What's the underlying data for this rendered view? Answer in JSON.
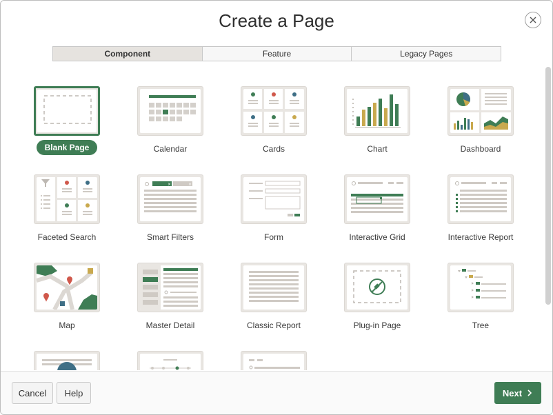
{
  "dialog": {
    "title": "Create a Page"
  },
  "tabs": [
    {
      "label": "Component"
    },
    {
      "label": "Feature"
    },
    {
      "label": "Legacy Pages"
    }
  ],
  "pages": [
    {
      "label": "Blank Page"
    },
    {
      "label": "Calendar"
    },
    {
      "label": "Cards"
    },
    {
      "label": "Chart"
    },
    {
      "label": "Dashboard"
    },
    {
      "label": "Faceted Search"
    },
    {
      "label": "Smart Filters"
    },
    {
      "label": "Form"
    },
    {
      "label": "Interactive Grid"
    },
    {
      "label": "Interactive Report"
    },
    {
      "label": "Map"
    },
    {
      "label": "Master Detail"
    },
    {
      "label": "Classic Report"
    },
    {
      "label": "Plug-in Page"
    },
    {
      "label": "Tree"
    }
  ],
  "footer": {
    "cancel": "Cancel",
    "help": "Help",
    "next": "Next"
  },
  "colors": {
    "accent": "#3f7d55",
    "gold": "#c9a94e",
    "red": "#d0584b",
    "blue": "#3f6f86"
  }
}
